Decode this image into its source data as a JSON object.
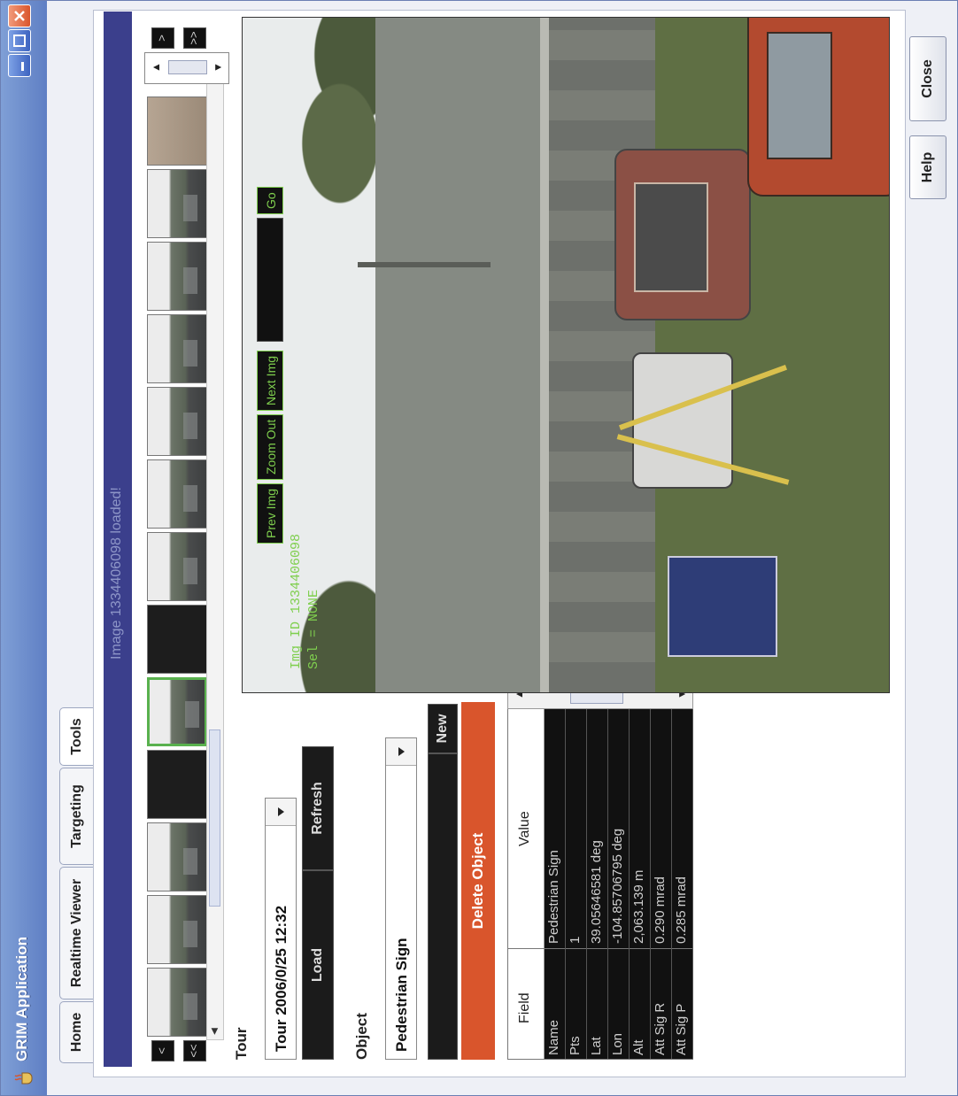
{
  "window": {
    "title": "GRIM Application",
    "controls": {
      "minimize": "minimize-icon",
      "maximize": "maximize-icon",
      "close": "close-icon"
    }
  },
  "tabs": [
    {
      "label": "Home"
    },
    {
      "label": "Realtime Viewer"
    },
    {
      "label": "Targeting"
    },
    {
      "label": "Tools"
    }
  ],
  "status": {
    "message": "Image 1334406098 loaded!"
  },
  "thumb_nav": {
    "prev": "<",
    "first": "<<",
    "next": ">",
    "last": ">>"
  },
  "tour": {
    "section_label": "Tour",
    "selected": "Tour 2006/0/25 12:32",
    "load_label": "Load",
    "refresh_label": "Refresh"
  },
  "object": {
    "section_label": "Object",
    "selected": "Pedestrian Sign",
    "new_label": "New",
    "delete_label": "Delete Object"
  },
  "table": {
    "headers": [
      "Field",
      "Value"
    ],
    "rows": [
      {
        "field": "Name",
        "value": "Pedestrian Sign"
      },
      {
        "field": "Pts",
        "value": "1"
      },
      {
        "field": "Lat",
        "value": "39.05646581 deg"
      },
      {
        "field": "Lon",
        "value": "-104.85706795 deg"
      },
      {
        "field": "Alt",
        "value": "2,063.139 m"
      },
      {
        "field": "Att Sig R",
        "value": "0.290 mrad"
      },
      {
        "field": "Att Sig P",
        "value": "0.285 mrad"
      }
    ]
  },
  "viewer": {
    "overlay_img_id": "Img ID 1334406098",
    "overlay_sel": "Sel = NONE",
    "prev_img": "Prev Img",
    "zoom_out": "Zoom Out",
    "next_img": "Next Img",
    "go": "Go"
  },
  "footer": {
    "help_label": "Help",
    "close_label": "Close"
  },
  "colors": {
    "title_bar": "#6f8fd0",
    "status_bar": "#3b3f8c",
    "delete_button": "#d9552c",
    "overlay_text": "#7fcf4e",
    "selected_thumb": "#59b14e"
  }
}
